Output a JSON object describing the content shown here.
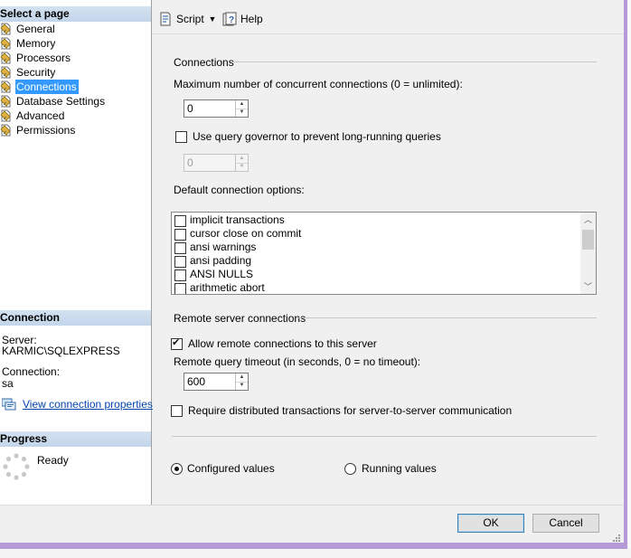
{
  "left": {
    "select_page_header": "Select a page",
    "pages": [
      {
        "label": "General",
        "selected": false,
        "icon": "page-icon"
      },
      {
        "label": "Memory",
        "selected": false,
        "icon": "page-icon"
      },
      {
        "label": "Processors",
        "selected": false,
        "icon": "page-icon"
      },
      {
        "label": "Security",
        "selected": false,
        "icon": "page-icon"
      },
      {
        "label": "Connections",
        "selected": true,
        "icon": "page-icon"
      },
      {
        "label": "Database Settings",
        "selected": false,
        "icon": "page-icon"
      },
      {
        "label": "Advanced",
        "selected": false,
        "icon": "page-icon"
      },
      {
        "label": "Permissions",
        "selected": false,
        "icon": "page-icon"
      }
    ],
    "connection_header": "Connection",
    "server_label": "Server:",
    "server_value": "KARMIC\\SQLEXPRESS",
    "connection_label": "Connection:",
    "connection_value": "sa",
    "view_props_link": "View connection properties",
    "progress_header": "Progress",
    "progress_status": "Ready"
  },
  "toolbar": {
    "script_label": "Script",
    "help_label": "Help"
  },
  "connections": {
    "group_title": "Connections",
    "max_concurrent_label": "Maximum number of concurrent connections (0 = unlimited):",
    "max_concurrent_value": "0",
    "query_governor_label": "Use query governor to prevent long-running queries",
    "query_governor_checked": false,
    "query_governor_value": "0",
    "default_options_label": "Default connection options:",
    "default_options": [
      {
        "label": "implicit transactions",
        "checked": false
      },
      {
        "label": "cursor close on commit",
        "checked": false
      },
      {
        "label": "ansi warnings",
        "checked": false
      },
      {
        "label": "ansi padding",
        "checked": false
      },
      {
        "label": "ANSI NULLS",
        "checked": false
      },
      {
        "label": "arithmetic abort",
        "checked": false
      }
    ]
  },
  "remote": {
    "group_title": "Remote server connections",
    "allow_remote_label": "Allow remote connections to this server",
    "allow_remote_checked": true,
    "timeout_label": "Remote query timeout (in seconds, 0 = no timeout):",
    "timeout_value": "600",
    "distributed_label": "Require distributed transactions for server-to-server communication",
    "distributed_checked": false
  },
  "view_mode": {
    "configured_label": "Configured values",
    "running_label": "Running values",
    "selected": "configured"
  },
  "buttons": {
    "ok": "OK",
    "cancel": "Cancel"
  }
}
